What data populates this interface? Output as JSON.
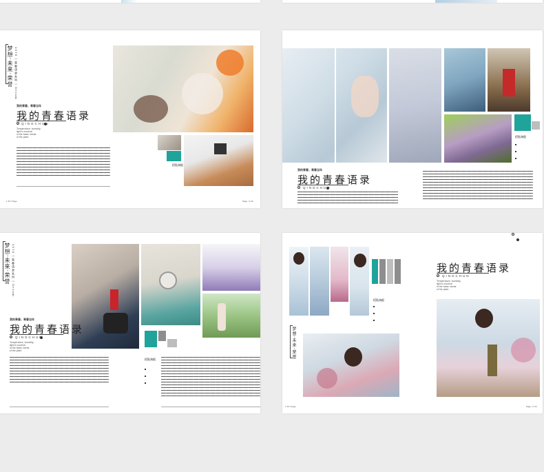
{
  "spreads": [
    {
      "title": "我的青春语录",
      "brand_line": "我的青春，青春当年",
      "romanized": "QINGCHUN",
      "latin_lines": [
        "Temperature, humidity,",
        "light is survival",
        "of the basic needs",
        "of the plant"
      ],
      "vertical_title": "梦想·未来·荣誉",
      "vertical_sub": "2018 | 青春语录系列 | Dream",
      "caption": "招贴海报",
      "page_left": "1·33 / Page",
      "page_right": "Page / 1·33"
    },
    {
      "title": "我的青春语录",
      "brand_line": "我的青春，青春当年",
      "romanized": "QINGCHUN",
      "caption": "招贴海报"
    },
    {
      "title": "我的青春语录",
      "brand_line": "我的青春，青春当年",
      "romanized": "QINGCHUN",
      "latin_lines": [
        "Temperature, humidity,",
        "light is survival",
        "of the basic needs",
        "of the plant"
      ],
      "vertical_title": "梦想·未来·荣誉",
      "vertical_sub": "2018 | 青春语录系列 | Dream",
      "caption": "招贴海报"
    },
    {
      "title": "我的青春语录",
      "romanized": "QINGCHUN",
      "latin_lines": [
        "Temperature, humidity,",
        "light is survival",
        "of the basic needs",
        "of the plant"
      ],
      "vertical_title": "梦想·未来·荣誉",
      "caption": "招贴海报",
      "page_left": "1·33 / Page",
      "page_right": "Page / 1·33"
    }
  ],
  "colors": {
    "accent": "#1fa39b",
    "grey_dark": "#8e8e8e",
    "grey_light": "#bdbdbd"
  }
}
